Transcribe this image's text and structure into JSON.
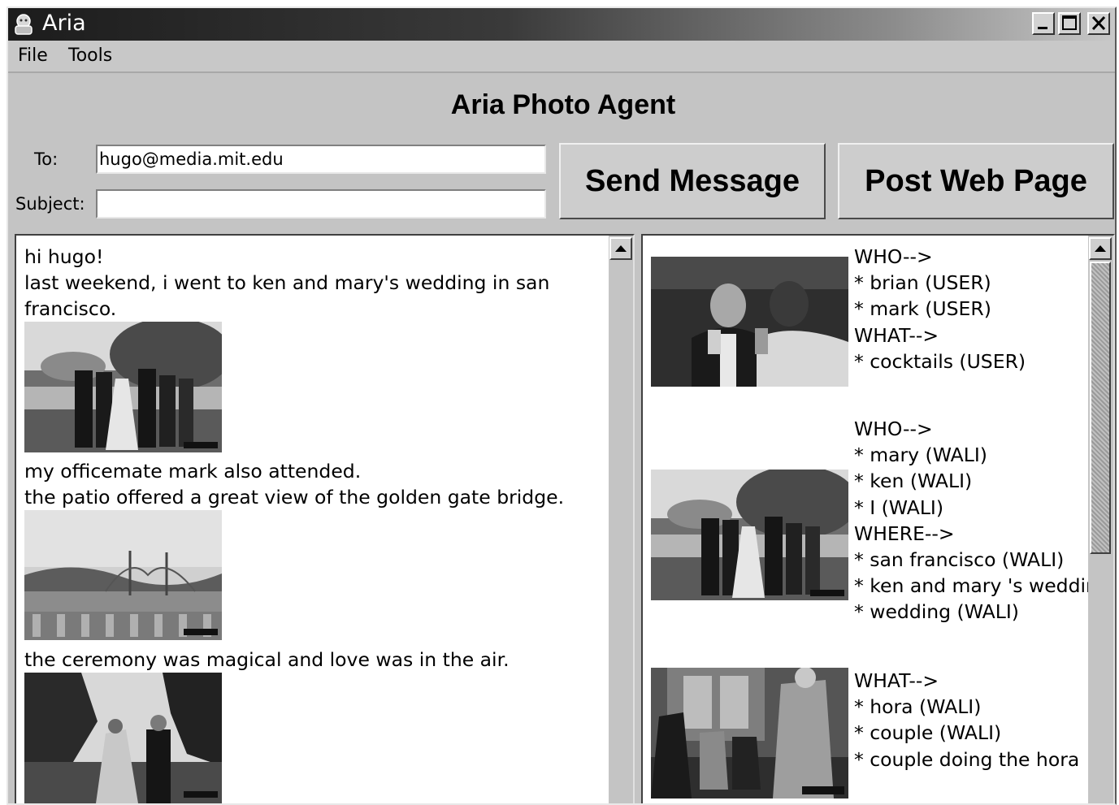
{
  "window": {
    "title": "Aria"
  },
  "menu": {
    "items": [
      "File",
      "Tools"
    ]
  },
  "main_title": "Aria Photo Agent",
  "compose": {
    "to_label": "To:",
    "to_value": "hugo@media.mit.edu",
    "subject_label": "Subject:",
    "subject_value": ""
  },
  "buttons": {
    "send": "Send Message",
    "post": "Post Web Page"
  },
  "message": {
    "paragraphs": [
      [
        "hi hugo!",
        "last weekend, i went to ken and mary's wedding in san",
        "francisco."
      ],
      [
        "my officemate mark also attended.",
        "the patio offered a great view of the golden gate bridge."
      ],
      [
        "the ceremony was magical and love was in the air."
      ]
    ],
    "photo_captions": [
      "wedding group photo on patio",
      "golden gate bridge view",
      "wedding ceremony"
    ]
  },
  "annotations": [
    {
      "lines": [
        "WHO-->",
        "* brian (USER)",
        "* mark (USER)",
        "WHAT-->",
        "* cocktails (USER)"
      ]
    },
    {
      "lines": [
        "WHO-->",
        "* mary (WALI)",
        "* ken (WALI)",
        "* I (WALI)",
        "WHERE-->",
        "* san francisco (WALI)",
        "* ken and mary 's wedding",
        "* wedding (WALI)"
      ]
    },
    {
      "lines": [
        "WHAT-->",
        "* hora (WALI)",
        "* couple (WALI)",
        "* couple doing the hora"
      ]
    }
  ]
}
